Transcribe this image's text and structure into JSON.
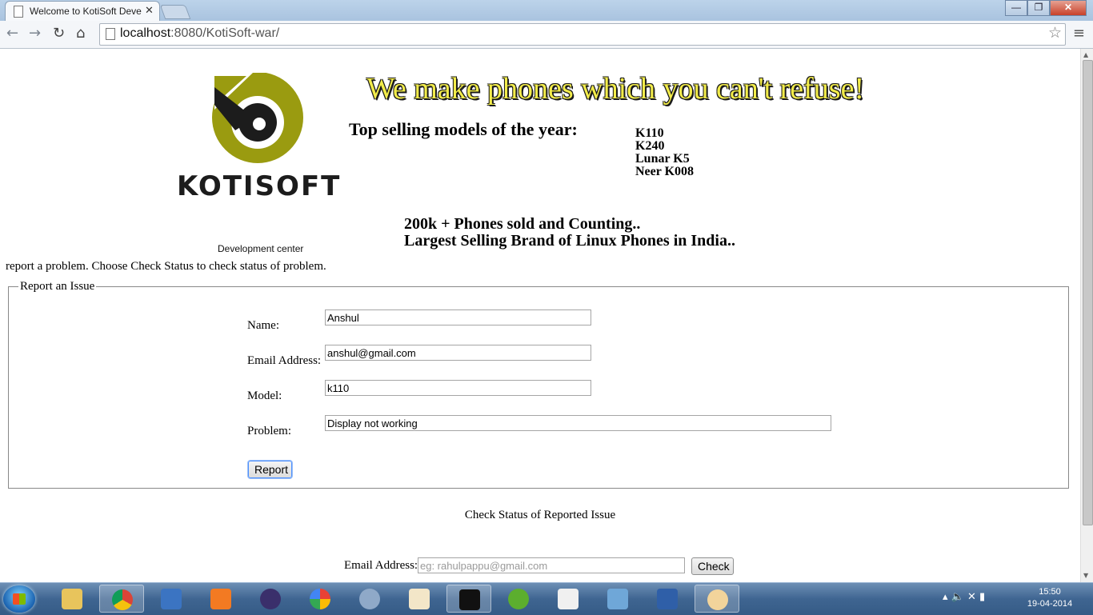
{
  "browser": {
    "tab_title": "Welcome to KotiSoft Deve",
    "tab_close": "✕",
    "url_host": "localhost",
    "url_rest": ":8080/KotiSoft-war/",
    "back": "←",
    "forward": "→",
    "reload": "↻",
    "home": "⌂",
    "star": "☆",
    "menu": "≡",
    "window_minimize": "—",
    "window_maximize": "❐",
    "window_close": "✕"
  },
  "header": {
    "logo_text": "KOTISOFT",
    "dev_center": "Development center",
    "headline": "We make phones which you can't refuse!",
    "top_selling_label": "Top selling models of the year:",
    "models": [
      "K110",
      "K240",
      "Lunar K5",
      "Neer K008"
    ],
    "stats": [
      "200k + Phones sold and Counting..",
      "Largest Selling Brand of Linux Phones in India.."
    ],
    "logo_colors": {
      "olive": "#9a9b10",
      "dark": "#1c1c1c"
    }
  },
  "intro_text": "report a problem. Choose Check Status to check status of problem.",
  "report_form": {
    "legend": "Report an Issue",
    "name_label": "Name:",
    "name_value": "Anshul",
    "email_label": "Email Address:",
    "email_value": "anshul@gmail.com",
    "model_label": "Model:",
    "model_value": "k110",
    "problem_label": "Problem:",
    "problem_value": "Display not working",
    "submit_label": "Report"
  },
  "check_status": {
    "title": "Check Status of Reported Issue",
    "email_label": "Email Address:",
    "email_placeholder": "eg: rahulpappu@gmail.com",
    "button_label": "Check"
  },
  "taskbar": {
    "icons": [
      "file-explorer-icon",
      "chrome-icon",
      "virtualbox-icon",
      "xampp-icon",
      "eclipse-icon",
      "picasa-icon",
      "settings-icon",
      "notes-icon",
      "cmd-icon",
      "utorrent-icon",
      "apps-icon",
      "network-icon",
      "remote-icon",
      "paint-icon"
    ],
    "clock_time": "15:50",
    "clock_date": "19-04-2014"
  }
}
